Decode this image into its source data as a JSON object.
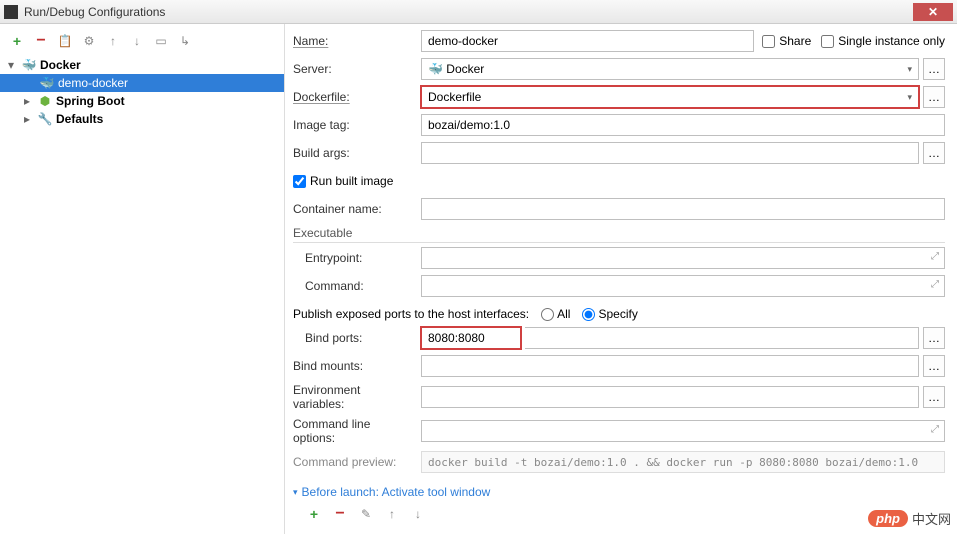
{
  "window": {
    "title": "Run/Debug Configurations"
  },
  "top_right": {
    "share": "Share",
    "single_instance": "Single instance only"
  },
  "tree": {
    "items": [
      {
        "label": "Docker",
        "expanded": true,
        "children": [
          {
            "label": "demo-docker",
            "selected": true
          }
        ]
      },
      {
        "label": "Spring Boot"
      },
      {
        "label": "Defaults"
      }
    ]
  },
  "form": {
    "name_label": "Name:",
    "name_value": "demo-docker",
    "server_label": "Server:",
    "server_value": "Docker",
    "dockerfile_label": "Dockerfile:",
    "dockerfile_value": "Dockerfile",
    "image_tag_label": "Image tag:",
    "image_tag_value": "bozai/demo:1.0",
    "build_args_label": "Build args:",
    "build_args_value": "",
    "run_built_label": "Run built image",
    "run_built_checked": true,
    "container_name_label": "Container name:",
    "container_name_value": "",
    "executable_header": "Executable",
    "entrypoint_label": "Entrypoint:",
    "entrypoint_value": "",
    "command_label": "Command:",
    "command_value": "",
    "publish_label": "Publish exposed ports to the host interfaces:",
    "publish_all": "All",
    "publish_specify": "Specify",
    "publish_selected": "specify",
    "bind_ports_label": "Bind ports:",
    "bind_ports_value": "8080:8080",
    "bind_mounts_label": "Bind mounts:",
    "bind_mounts_value": "",
    "env_label": "Environment variables:",
    "env_value": "",
    "cmd_opts_label": "Command line options:",
    "cmd_opts_value": "",
    "preview_label": "Command preview:",
    "preview_value": "docker build -t bozai/demo:1.0 . && docker run -p 8080:8080 bozai/demo:1.0"
  },
  "before_launch": {
    "header": "Before launch: Activate tool window"
  },
  "watermark": {
    "logo": "php",
    "text": "中文网"
  }
}
